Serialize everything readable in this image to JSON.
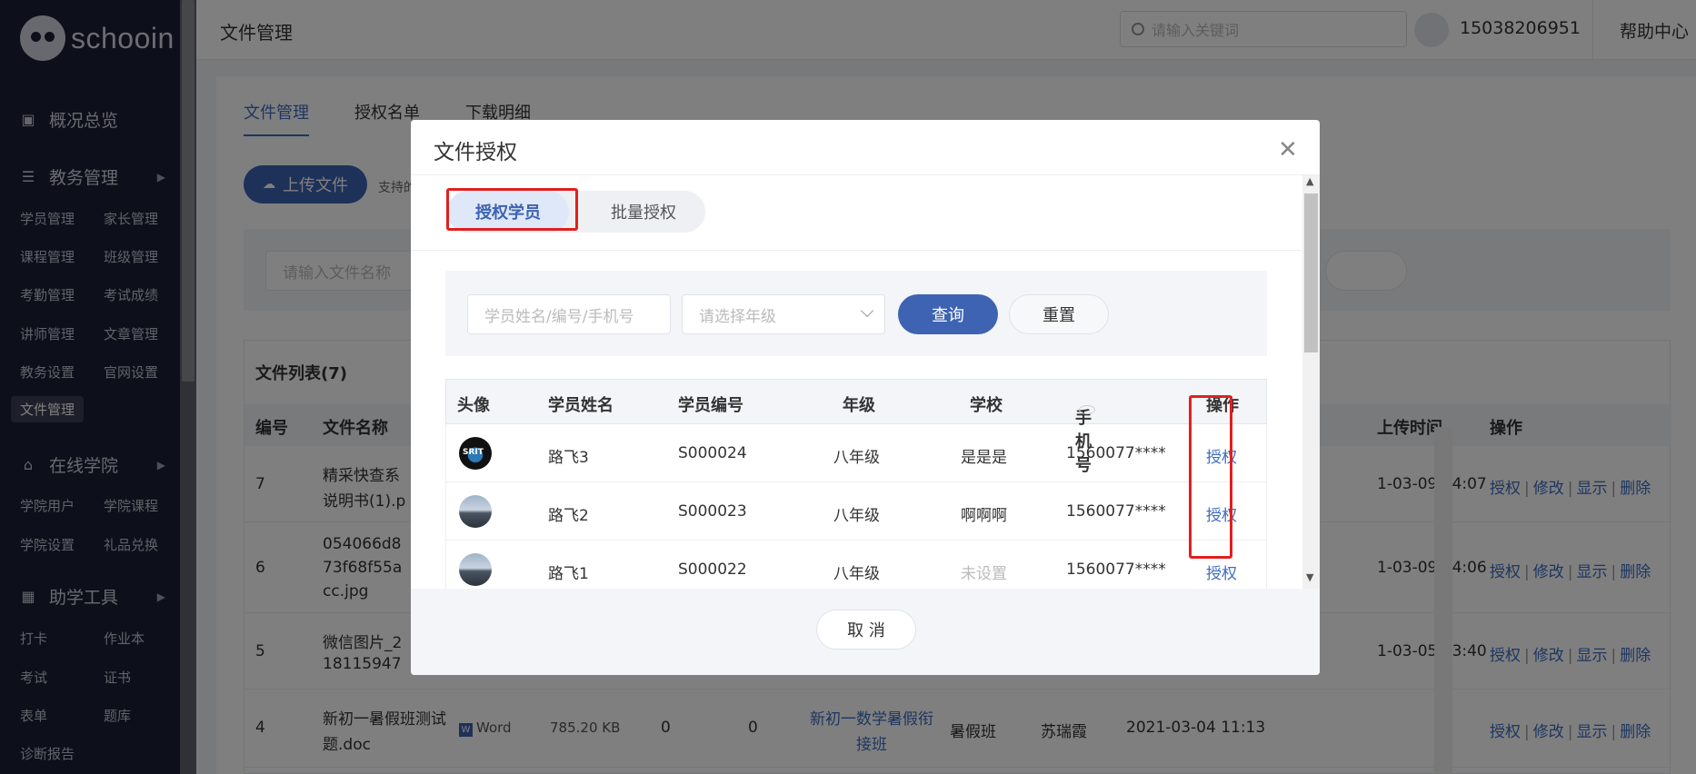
{
  "app": {
    "logo_text": "schooin"
  },
  "sidebar": {
    "sections": [
      {
        "label": "概况总览",
        "icon": "monitor-icon",
        "has_arrow": false
      },
      {
        "label": "教务管理",
        "icon": "stack-icon",
        "has_arrow": true
      },
      {
        "label": "在线学院",
        "icon": "graduation-cap-icon",
        "has_arrow": true
      },
      {
        "label": "助学工具",
        "icon": "grid-icon",
        "has_arrow": true
      }
    ],
    "edu_items": [
      "学员管理",
      "家长管理",
      "课程管理",
      "班级管理",
      "考勤管理",
      "考试成绩",
      "讲师管理",
      "文章管理",
      "教务设置",
      "官网设置",
      "文件管理"
    ],
    "college_items": [
      "学院用户",
      "学院课程",
      "学院设置",
      "礼品兑换"
    ],
    "tool_items": [
      "打卡",
      "作业本",
      "考试",
      "证书",
      "表单",
      "题库",
      "诊断报告"
    ],
    "active_item": "文件管理"
  },
  "topbar": {
    "title": "文件管理",
    "search_placeholder": "请输入关键词",
    "phone": "15038206951",
    "help": "帮助中心"
  },
  "main": {
    "tabs": [
      "文件管理",
      "授权名单",
      "下载明细"
    ],
    "active_tab": "文件管理",
    "upload_label": "上传文件",
    "upload_hint": "支持的",
    "filter_placeholder": "请输入文件名称",
    "list_title": "文件列表(7)",
    "columns": [
      "编号",
      "文件名称",
      "上传时间",
      "操作"
    ],
    "rows": [
      {
        "id": "7",
        "name_l1": "精采快查系",
        "name_l2": "说明书(1).p",
        "time": "1-03-09 14:07"
      },
      {
        "id": "6",
        "name_l1": "054066d8",
        "name_l2": "73f68f55a",
        "name_l3": "cc.jpg",
        "time": "1-03-09 14:06"
      },
      {
        "id": "5",
        "name_l1": "微信图片_2",
        "name_l2": "18115947",
        "time": "1-03-05 13:40"
      },
      {
        "id": "4",
        "name_l1": "新初一暑假班测试",
        "name_l2": "题.doc",
        "type": "Word",
        "size": "785.20 KB",
        "c1": "0",
        "c2": "0",
        "course_l1": "新初一数学暑假衔",
        "course_l2": "接班",
        "class": "暑假班",
        "teacher": "苏瑞霞",
        "time": "2021-03-04 11:13"
      }
    ],
    "row_actions": [
      "授权",
      "修改",
      "显示",
      "删除"
    ]
  },
  "modal": {
    "title": "文件授权",
    "segment_tabs": [
      "授权学员",
      "批量授权"
    ],
    "active_segment": "授权学员",
    "search_placeholder": "学员姓名/编号/手机号",
    "grade_placeholder": "请选择年级",
    "query_label": "查询",
    "reset_label": "重置",
    "columns": [
      "头像",
      "学员姓名",
      "学员编号",
      "年级",
      "学校",
      "手机号",
      "操作"
    ],
    "students": [
      {
        "name": "路飞3",
        "id": "S000024",
        "grade": "八年级",
        "school": "是是是",
        "phone": "1560077****",
        "action": "授权",
        "avatar_logo_text": "SRIT"
      },
      {
        "name": "路飞2",
        "id": "S000023",
        "grade": "八年级",
        "school": "啊啊啊",
        "phone": "1560077****",
        "action": "授权"
      },
      {
        "name": "路飞1",
        "id": "S000022",
        "grade": "八年级",
        "school": "未设置",
        "phone": "1560077****",
        "action": "授权"
      }
    ],
    "cancel_label": "取 消"
  },
  "colors": {
    "primary": "#3d63b2",
    "link": "#3d6cc0",
    "highlight": "#e0201f",
    "sidebar_bg": "#1a1f36"
  }
}
